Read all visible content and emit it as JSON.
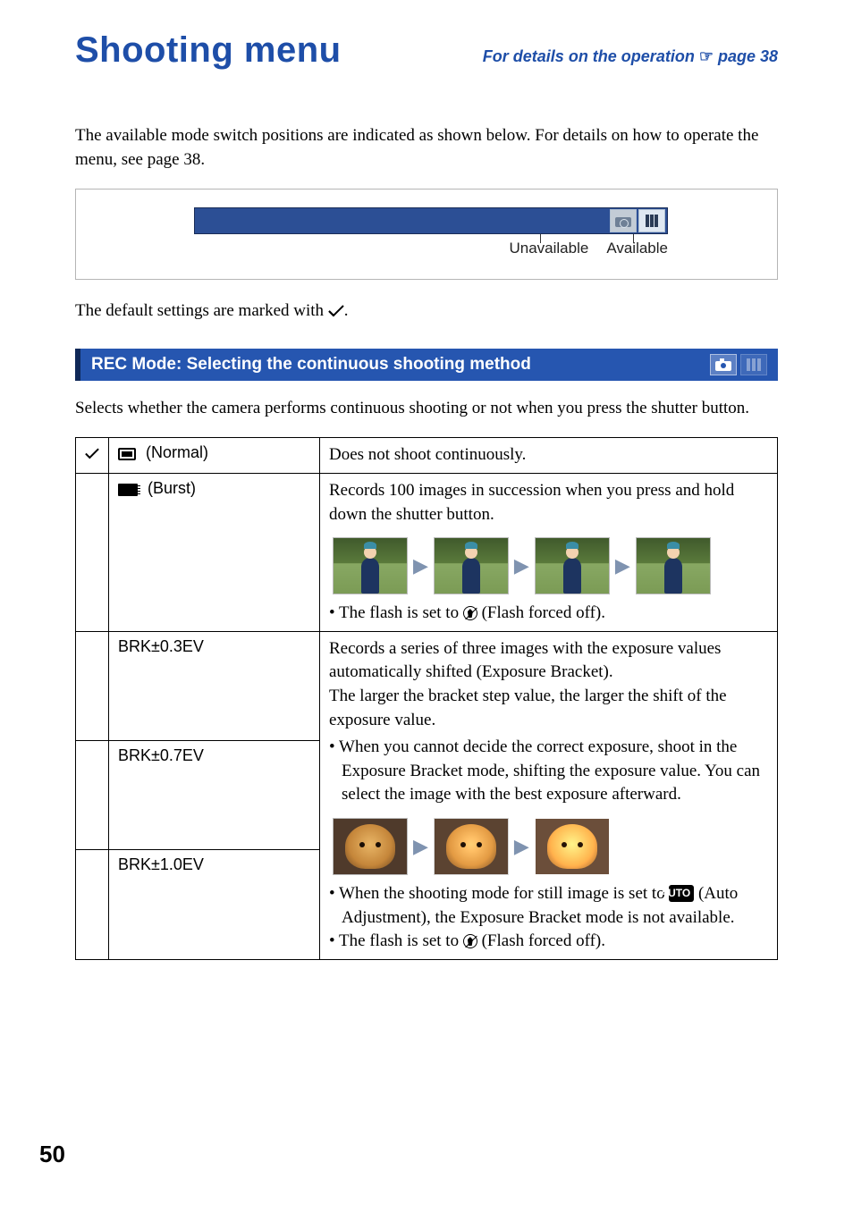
{
  "header": {
    "title": "Shooting menu",
    "ref_prefix": "For details on the operation ",
    "ref_hand": "☞",
    "ref_suffix": " page 38"
  },
  "intro": "The available mode switch positions are indicated as shown below. For details on how to operate the menu, see page 38.",
  "figure": {
    "unavailable": "Unavailable",
    "available": "Available"
  },
  "defaults_line_a": "The default settings are marked with ",
  "defaults_line_b": ".",
  "section1": {
    "title": "REC Mode: Selecting the continuous shooting method"
  },
  "section1_intro": "Selects whether the camera performs continuous shooting or not when you press the shutter button.",
  "table": {
    "normal": {
      "label": " (Normal)",
      "desc": "Does not shoot continuously."
    },
    "burst": {
      "label": " (Burst)",
      "desc": "Records 100 images in succession when you press and hold down the shutter button.",
      "note_prefix": "• The flash is set to ",
      "note_suffix": " (Flash forced off)."
    },
    "brk1": {
      "label": "BRK±0.3EV"
    },
    "brk2": {
      "label": "BRK±0.7EV"
    },
    "brk3": {
      "label": "BRK±1.0EV"
    },
    "brk_desc1": "Records a series of three images with the exposure values automatically shifted (Exposure Bracket).",
    "brk_desc2": "The larger the bracket step value, the larger the shift of the exposure value.",
    "brk_tip": "• When you cannot decide the correct exposure, shoot in the Exposure Bracket mode, shifting the exposure value. You can select the image with the best exposure afterward.",
    "brk_note_a": "• When the shooting mode for still image is set to ",
    "brk_note_auto": "AUTO",
    "brk_note_b": " (Auto Adjustment), the Exposure Bracket mode is not available.",
    "brk_note2_prefix": "• The flash is set to ",
    "brk_note2_suffix": " (Flash forced off)."
  },
  "page_number": "50"
}
